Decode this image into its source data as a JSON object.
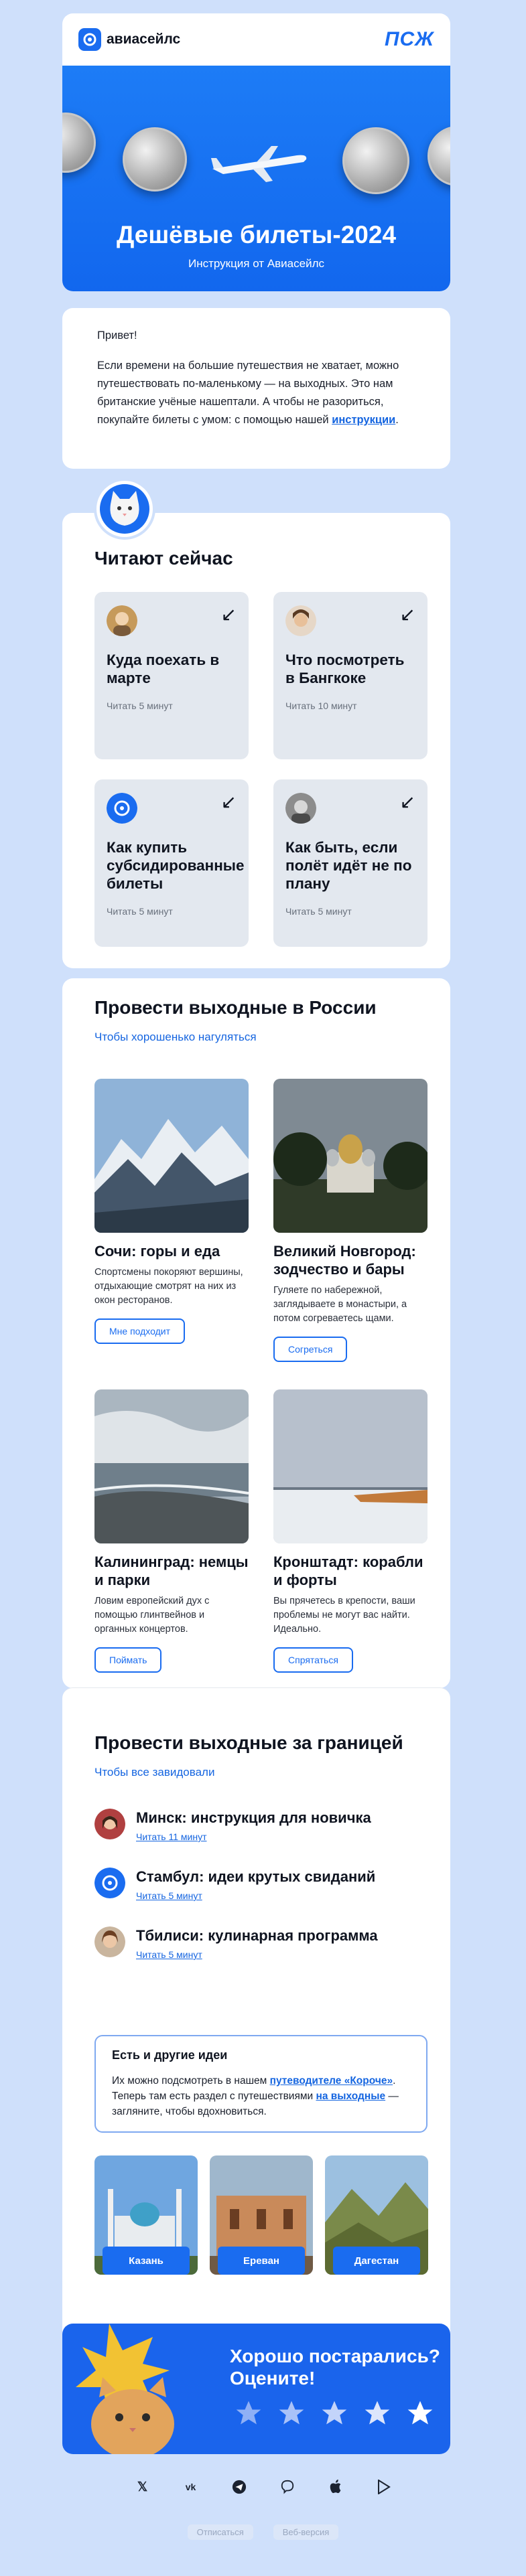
{
  "header": {
    "logo_text": "авиасейлс",
    "partner_logo": "ПСЖ",
    "title": "Дешёвые билеты-2024",
    "subtitle": "Инструкция от Авиасейлс"
  },
  "intro": {
    "greeting": "Привет!",
    "text_before_link": "Если времени на большие путешествия не хватает, можно путешествовать по-маленькому — на выходных. Это нам британские учёные нашептали. А чтобы не разориться, покупайте билеты с умом: с помощью нашей ",
    "link_text": "инструкции",
    "text_after_link": "."
  },
  "reading": {
    "title": "Читают сейчас",
    "arrow": "↙",
    "items": [
      {
        "title": "Куда поехать в марте",
        "meta": "Читать 5 минут"
      },
      {
        "title": "Что посмотреть в Бангкоке",
        "meta": "Читать 10 минут"
      },
      {
        "title": "Как купить субсидированные билеты",
        "meta": "Читать 5 минут"
      },
      {
        "title": "Как быть, если полёт идёт не по плану",
        "meta": "Читать 5 минут"
      }
    ]
  },
  "russia": {
    "title": "Провести выходные в России",
    "subtitle": "Чтобы хорошенько нагуляться",
    "places": [
      {
        "title": "Сочи: горы и еда",
        "text": "Спортсмены покоряют вершины, отдыхающие смотрят на них из окон ресторанов.",
        "button": "Мне подходит"
      },
      {
        "title": "Великий Новгород: зодчество и бары",
        "text": "Гуляете по набережной, заглядываете в монастыри, а потом согреваетесь щами.",
        "button": "Согреться"
      },
      {
        "title": "Калининград: немцы и парки",
        "text": "Ловим европейский дух с помощью глинтвейнов и органных концертов.",
        "button": "Поймать"
      },
      {
        "title": "Кронштадт: корабли и форты",
        "text": "Вы пряче­тесь в крепости, ваши проблемы не могут вас найти. Идеально.",
        "button": "Спрятаться"
      }
    ]
  },
  "abroad": {
    "title": "Провести выходные за границей",
    "subtitle": "Чтобы все завидовали",
    "items": [
      {
        "title": "Минск: инструкция для новичка",
        "meta": "Читать 11 минут"
      },
      {
        "title": "Стамбул: идеи крутых свиданий",
        "meta": "Читать 5 минут"
      },
      {
        "title": "Тбилиси: кулинарная программа",
        "meta": "Читать 5 минут"
      }
    ],
    "ideas": {
      "title": "Есть и другие идеи",
      "text_1": "Их можно подсмотреть в нашем ",
      "link_1": "путеводителе «Короче»",
      "text_2": ". Теперь там есть раздел с путешествиями ",
      "link_2": "на выходные",
      "text_3": " — загляните, чтобы вдохновиться."
    },
    "cities": [
      "Казань",
      "Ереван",
      "Дагестан"
    ]
  },
  "rating": {
    "title": "Хорошо постарались? Оцените!",
    "stars": 5
  },
  "social_icons": [
    "x-icon",
    "vk-icon",
    "telegram-icon",
    "viber-icon",
    "apple-icon",
    "google-play-icon"
  ],
  "footer": {
    "unsubscribe": "Отписаться",
    "web_version": "Веб-версия"
  },
  "colors": {
    "brand_blue": "#1a6cf0",
    "page_bg": "#cfe0fb",
    "link": "#1565e0"
  }
}
